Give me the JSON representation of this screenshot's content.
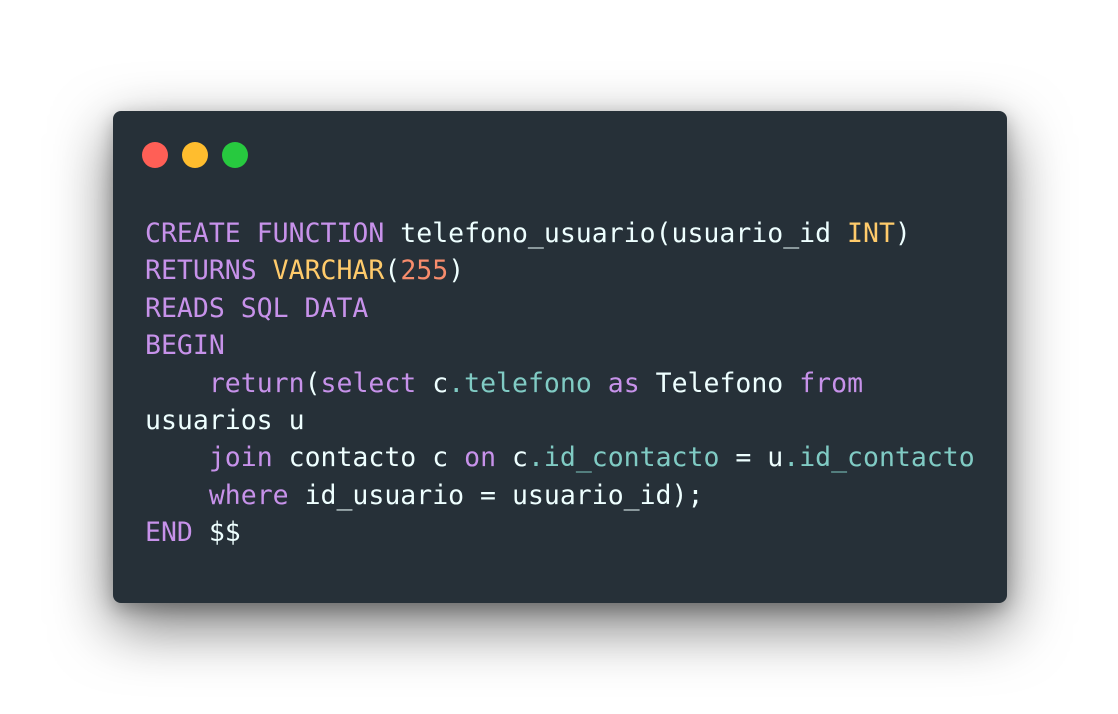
{
  "window": {
    "controls": [
      {
        "name": "close",
        "color": "#ff5f56"
      },
      {
        "name": "minimize",
        "color": "#ffbd2e"
      },
      {
        "name": "maximize",
        "color": "#27c93f"
      }
    ]
  },
  "colors": {
    "background": "#ffffff",
    "editor_background": "#263038",
    "keyword": "#c792ea",
    "type": "#ffcb6b",
    "number": "#f78c6c",
    "property": "#80cbc4",
    "text": "#eeffff"
  },
  "code": {
    "language": "sql",
    "lines": [
      [
        {
          "t": "CREATE",
          "k": "keyword"
        },
        {
          "t": " ",
          "k": "plain"
        },
        {
          "t": "FUNCTION",
          "k": "keyword"
        },
        {
          "t": " telefono_usuario(usuario_id ",
          "k": "plain"
        },
        {
          "t": "INT",
          "k": "type"
        },
        {
          "t": ")",
          "k": "plain"
        }
      ],
      [
        {
          "t": "RETURNS",
          "k": "keyword"
        },
        {
          "t": " ",
          "k": "plain"
        },
        {
          "t": "VARCHAR",
          "k": "type"
        },
        {
          "t": "(",
          "k": "plain"
        },
        {
          "t": "255",
          "k": "number"
        },
        {
          "t": ")",
          "k": "plain"
        }
      ],
      [
        {
          "t": "READS SQL DATA",
          "k": "keyword"
        }
      ],
      [
        {
          "t": "BEGIN",
          "k": "keyword"
        }
      ],
      [
        {
          "t": "    ",
          "k": "plain"
        },
        {
          "t": "return",
          "k": "keyword"
        },
        {
          "t": "(",
          "k": "plain"
        },
        {
          "t": "select",
          "k": "keyword"
        },
        {
          "t": " c",
          "k": "plain"
        },
        {
          "t": ".telefono",
          "k": "prop-name"
        },
        {
          "t": " ",
          "k": "plain"
        },
        {
          "t": "as",
          "k": "keyword"
        },
        {
          "t": " Telefono ",
          "k": "plain"
        },
        {
          "t": "from",
          "k": "keyword"
        }
      ],
      [
        {
          "t": "usuarios u",
          "k": "plain"
        }
      ],
      [
        {
          "t": "    ",
          "k": "plain"
        },
        {
          "t": "join",
          "k": "keyword"
        },
        {
          "t": " contacto c ",
          "k": "plain"
        },
        {
          "t": "on",
          "k": "keyword"
        },
        {
          "t": " c",
          "k": "plain"
        },
        {
          "t": ".id_contacto",
          "k": "prop-name"
        },
        {
          "t": " = u",
          "k": "plain"
        },
        {
          "t": ".id_contacto",
          "k": "prop-name"
        }
      ],
      [
        {
          "t": "    ",
          "k": "plain"
        },
        {
          "t": "where",
          "k": "keyword"
        },
        {
          "t": " id_usuario = usuario_id);",
          "k": "plain"
        }
      ],
      [
        {
          "t": "END",
          "k": "keyword"
        },
        {
          "t": " $$",
          "k": "plain"
        }
      ]
    ]
  }
}
